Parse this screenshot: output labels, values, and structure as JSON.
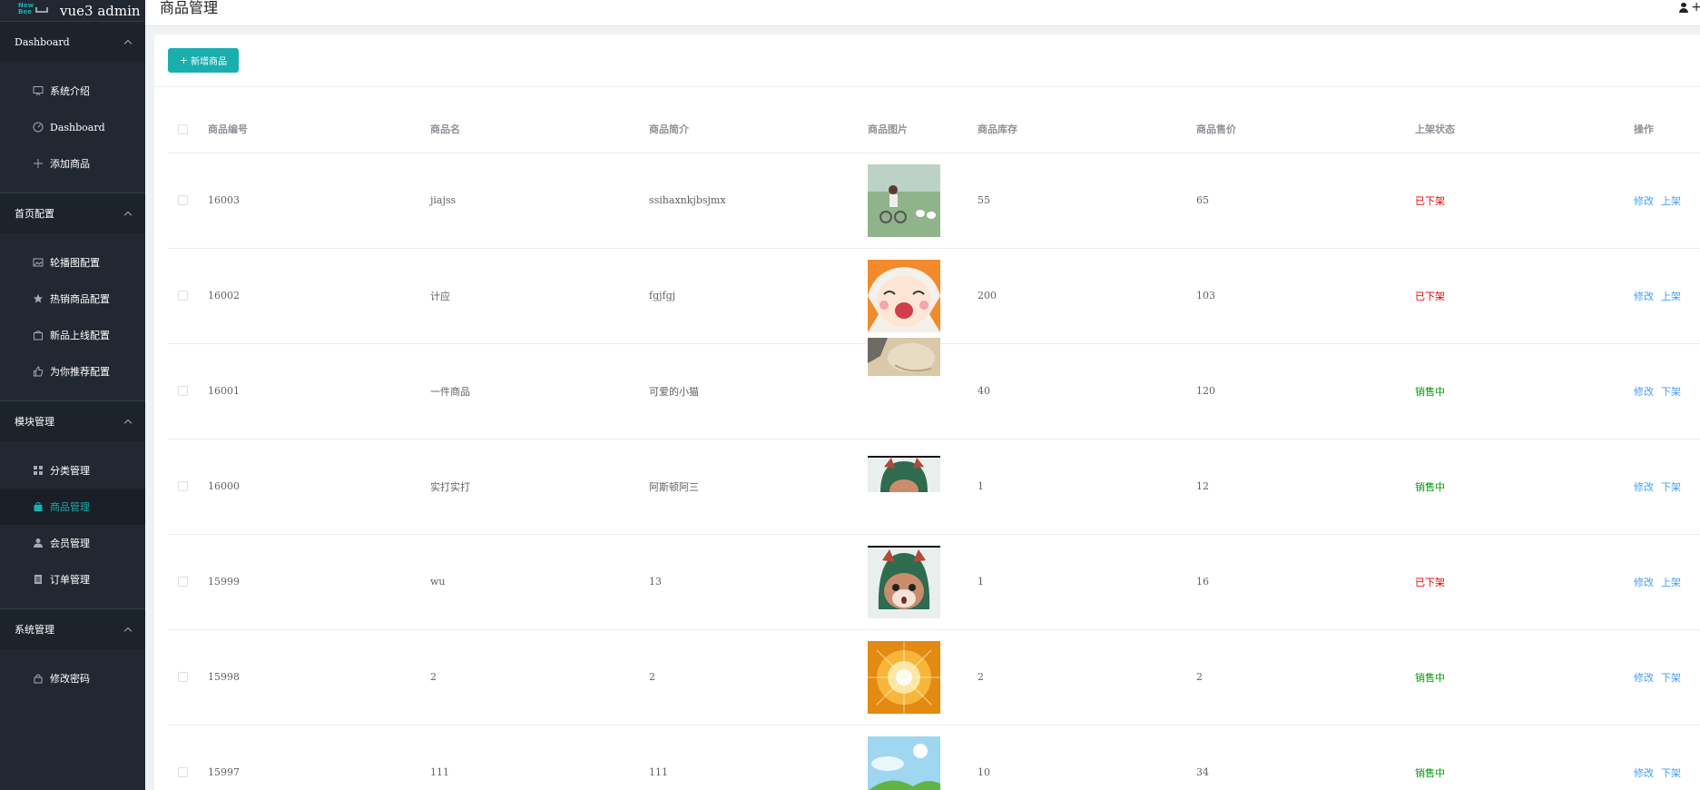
{
  "logo": {
    "mark_line1": "New",
    "mark_line2": "Bee",
    "title": "vue3 admin"
  },
  "sidebar": {
    "groups": [
      {
        "title": "Dashboard",
        "items": [
          {
            "label": "系统介绍",
            "icon": "presentation-icon"
          },
          {
            "label": "Dashboard",
            "icon": "dashboard-gauge-icon"
          },
          {
            "label": "添加商品",
            "icon": "plus-icon"
          }
        ]
      },
      {
        "title": "首页配置",
        "items": [
          {
            "label": "轮播图配置",
            "icon": "picture-icon"
          },
          {
            "label": "热销商品配置",
            "icon": "star-icon"
          },
          {
            "label": "新品上线配置",
            "icon": "new-goods-icon"
          },
          {
            "label": "为你推荐配置",
            "icon": "thumb-icon"
          }
        ]
      },
      {
        "title": "模块管理",
        "items": [
          {
            "label": "分类管理",
            "icon": "grid-icon"
          },
          {
            "label": "商品管理",
            "icon": "goods-bag-icon",
            "active": true
          },
          {
            "label": "会员管理",
            "icon": "user-icon"
          },
          {
            "label": "订单管理",
            "icon": "order-list-icon"
          }
        ]
      },
      {
        "title": "系统管理",
        "items": [
          {
            "label": "修改密码",
            "icon": "lock-icon"
          }
        ]
      }
    ]
  },
  "header": {
    "title": "商品管理"
  },
  "toolbar": {
    "add_label": "新增商品"
  },
  "table": {
    "columns": [
      "商品编号",
      "商品名",
      "商品简介",
      "商品图片",
      "商品库存",
      "商品售价",
      "上架状态",
      "操作"
    ],
    "edit_label": "修改",
    "rows": [
      {
        "id": "16003",
        "name": "jiajss",
        "intro": "ssihaxnkjbsjmx",
        "stock": "55",
        "price": "65",
        "status": "已下架",
        "action": "上架",
        "on_sale": false,
        "image": "boy-bicycle-photo"
      },
      {
        "id": "16002",
        "name": "计应",
        "intro": "fgjfgj",
        "stock": "200",
        "price": "103",
        "status": "已下架",
        "action": "上架",
        "on_sale": false,
        "image": "anime-girl-laughing"
      },
      {
        "id": "16001",
        "name": "一件商品",
        "intro": "可爱的小猫",
        "stock": "40",
        "price": "120",
        "status": "销售中",
        "action": "下架",
        "on_sale": true,
        "image": "cat-photo"
      },
      {
        "id": "16000",
        "name": "实打实打",
        "intro": "阿斯顿阿三",
        "stock": "1",
        "price": "12",
        "status": "销售中",
        "action": "下架",
        "on_sale": true,
        "image": "cartoon-avatar-partial"
      },
      {
        "id": "15999",
        "name": "wu",
        "intro": "13",
        "stock": "1",
        "price": "16",
        "status": "已下架",
        "action": "上架",
        "on_sale": false,
        "image": "cartoon-avatar"
      },
      {
        "id": "15998",
        "name": "2",
        "intro": "2",
        "stock": "2",
        "price": "2",
        "status": "销售中",
        "action": "下架",
        "on_sale": true,
        "image": "golden-burst"
      },
      {
        "id": "15997",
        "name": "111",
        "intro": "111",
        "stock": "10",
        "price": "34",
        "status": "销售中",
        "action": "下架",
        "on_sale": true,
        "image": "sky-hills"
      }
    ]
  },
  "colors": {
    "accent": "#1baeae",
    "sidebar_bg": "#222832",
    "link": "#409eff",
    "off_sale": "#ee0000",
    "on_sale": "#009900"
  }
}
